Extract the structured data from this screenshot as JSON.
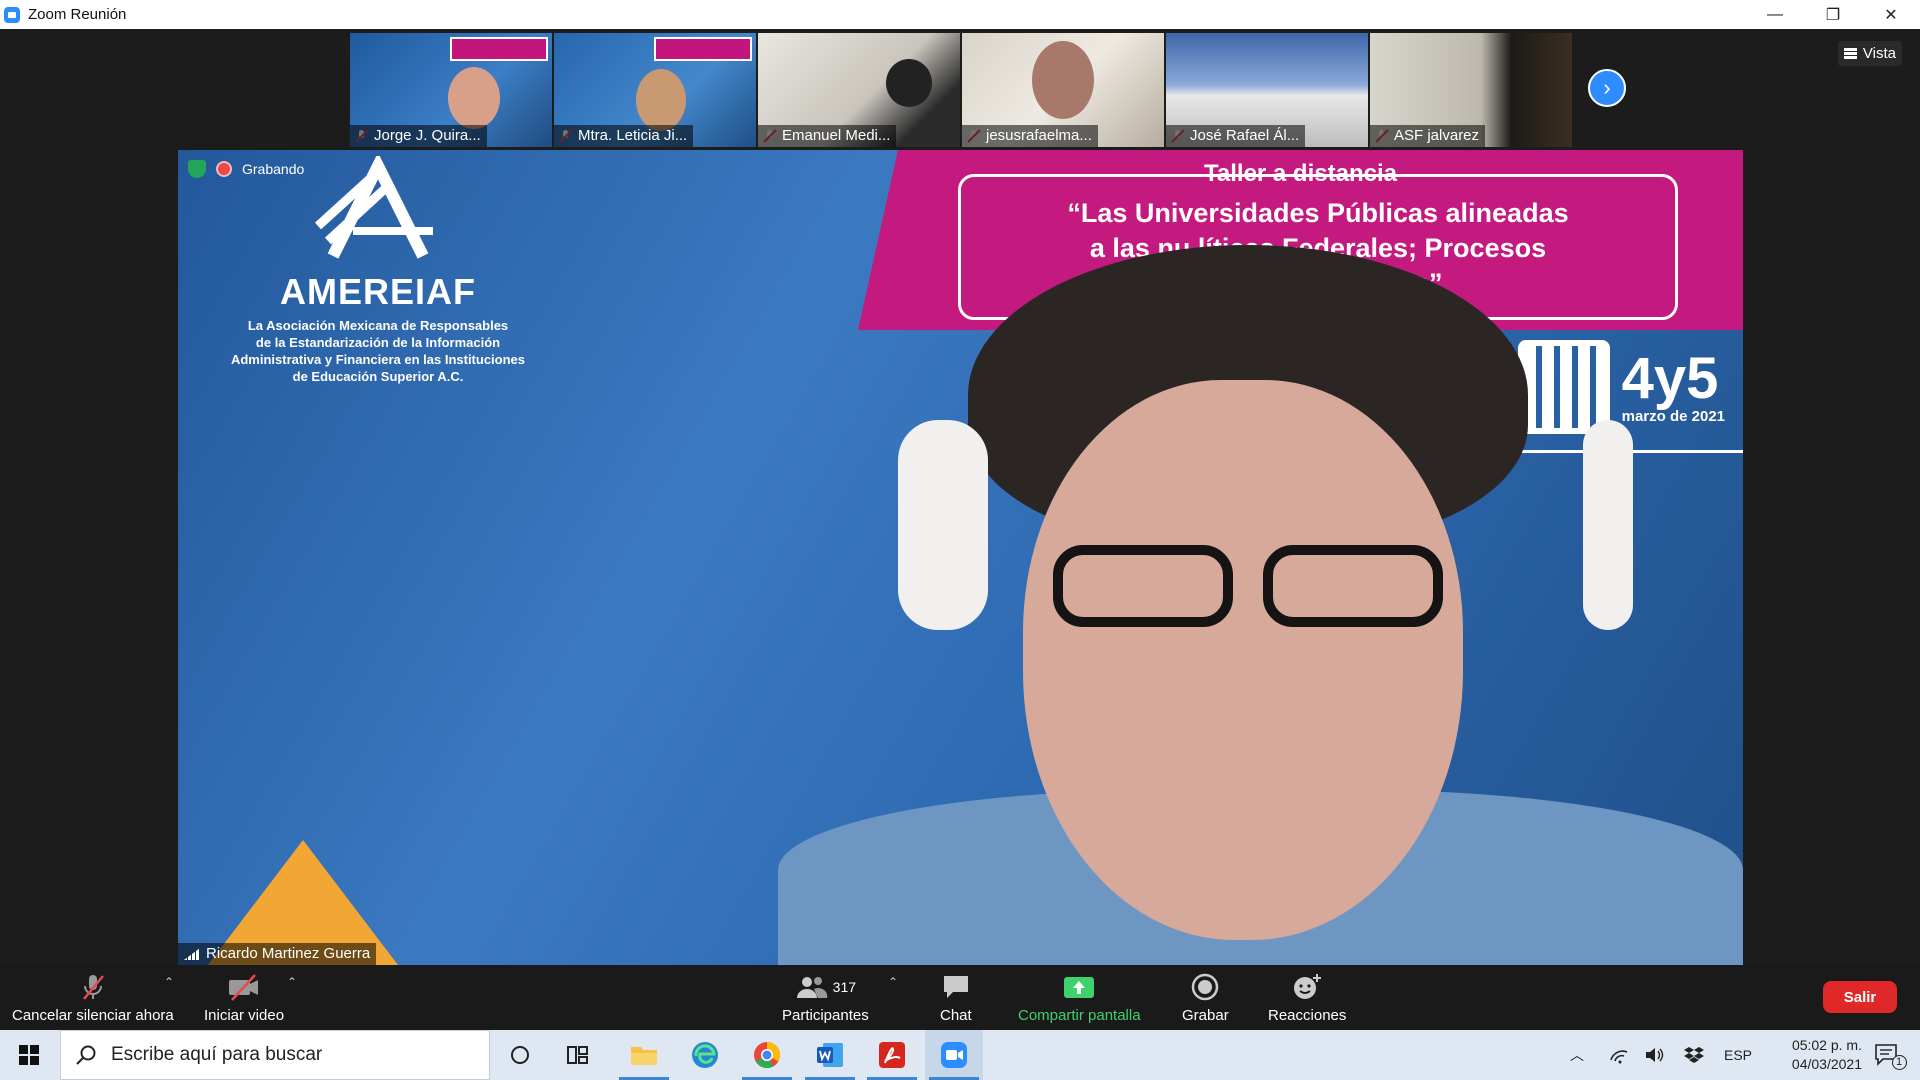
{
  "window": {
    "title": "Zoom Reunión",
    "minimize": "—",
    "maximize": "❐",
    "close": "✕"
  },
  "view_button": {
    "label": "Vista"
  },
  "participants_strip": [
    {
      "name": "Jorge J. Quira..."
    },
    {
      "name": "Mtra. Leticia Ji..."
    },
    {
      "name": "Emanuel Medi..."
    },
    {
      "name": "jesusrafaelma..."
    },
    {
      "name": "José Rafael Ál..."
    },
    {
      "name": "ASF jalvarez"
    }
  ],
  "main_video": {
    "recording_label": "Grabando",
    "speaker_name": "Ricardo Martinez Guerra",
    "slide": {
      "org_name": "AMEREIAF",
      "org_description": "La Asociación Mexicana de Responsables\nde la Estandarización de la Información\nAdministrativa y Financiera en las Instituciones\nde Educación Superior A.C.",
      "banner_title": "Taller a distancia",
      "banner_text": "“Las Universidades Públicas alineadas\na las nu      líticas Federales; Procesos\n               Gestión Educativa”",
      "date_main": "4y5",
      "date_sub": "marzo de 2021"
    }
  },
  "controls": {
    "mute": "Cancelar silenciar ahora",
    "video": "Iniciar video",
    "participants": "Participantes",
    "participants_count": "317",
    "chat": "Chat",
    "share": "Compartir pantalla",
    "record": "Grabar",
    "reactions": "Reacciones",
    "leave": "Salir"
  },
  "colors": {
    "accent": "#2d8cff",
    "share_green": "#3fd16b",
    "leave_red": "#e02828",
    "banner_magenta": "#c4197e"
  },
  "taskbar": {
    "search_placeholder": "Escribe aquí para buscar",
    "language": "ESP",
    "time": "05:02 p. m.",
    "date": "04/03/2021",
    "notification_count": "1"
  }
}
